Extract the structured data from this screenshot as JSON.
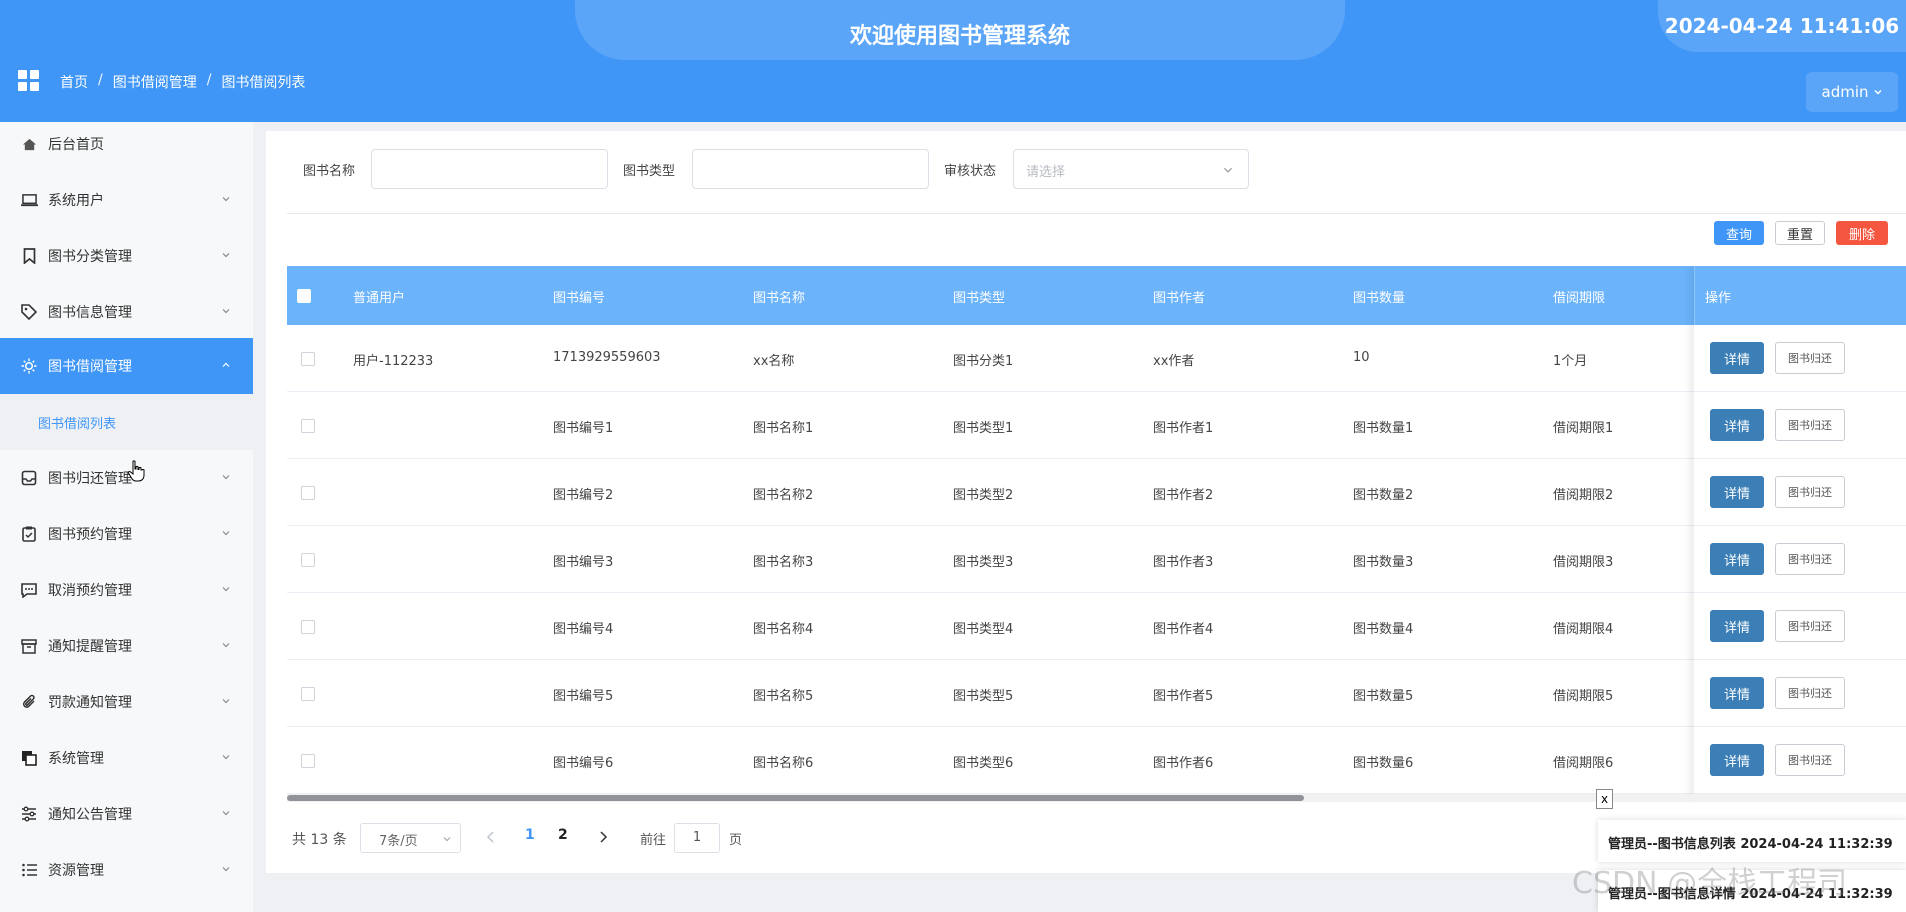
{
  "header": {
    "title": "欢迎使用图书管理系统",
    "clock": "2024-04-24 11:41:06",
    "breadcrumb": [
      "首页",
      "图书借阅管理",
      "图书借阅列表"
    ],
    "user": "admin"
  },
  "sidebar": {
    "items": [
      {
        "label": "后台首页",
        "icon": "home-icon"
      },
      {
        "label": "系统用户",
        "icon": "laptop-icon"
      },
      {
        "label": "图书分类管理",
        "icon": "bookmark-icon"
      },
      {
        "label": "图书信息管理",
        "icon": "tag-icon"
      },
      {
        "label": "图书借阅管理",
        "icon": "sun-icon",
        "active": true
      },
      {
        "label": "图书归还管理",
        "icon": "inbox-icon"
      },
      {
        "label": "图书预约管理",
        "icon": "clipboard-icon"
      },
      {
        "label": "取消预约管理",
        "icon": "chat-icon"
      },
      {
        "label": "通知提醒管理",
        "icon": "archive-icon"
      },
      {
        "label": "罚款通知管理",
        "icon": "paperclip-icon"
      },
      {
        "label": "系统管理",
        "icon": "copy-icon"
      },
      {
        "label": "通知公告管理",
        "icon": "sliders-icon"
      },
      {
        "label": "资源管理",
        "icon": "list-icon"
      }
    ],
    "submenu": {
      "label": "图书借阅列表"
    }
  },
  "search": {
    "book_name_label": "图书名称",
    "book_type_label": "图书类型",
    "audit_label": "审核状态",
    "audit_placeholder": "请选择"
  },
  "actions": {
    "query": "查询",
    "reset": "重置",
    "delete": "删除"
  },
  "table": {
    "headers": [
      "普通用户",
      "图书编号",
      "图书名称",
      "图书类型",
      "图书作者",
      "图书数量",
      "借阅期限"
    ],
    "ops_header": "操作",
    "detail_label": "详情",
    "return_label": "图书归还",
    "rows": [
      [
        "用户-112233",
        "1713929559603",
        "xx名称",
        "图书分类1",
        "xx作者",
        "10",
        "1个月"
      ],
      [
        "",
        "图书编号1",
        "图书名称1",
        "图书类型1",
        "图书作者1",
        "图书数量1",
        "借阅期限1"
      ],
      [
        "",
        "图书编号2",
        "图书名称2",
        "图书类型2",
        "图书作者2",
        "图书数量2",
        "借阅期限2"
      ],
      [
        "",
        "图书编号3",
        "图书名称3",
        "图书类型3",
        "图书作者3",
        "图书数量3",
        "借阅期限3"
      ],
      [
        "",
        "图书编号4",
        "图书名称4",
        "图书类型4",
        "图书作者4",
        "图书数量4",
        "借阅期限4"
      ],
      [
        "",
        "图书编号5",
        "图书名称5",
        "图书类型5",
        "图书作者5",
        "图书数量5",
        "借阅期限5"
      ],
      [
        "",
        "图书编号6",
        "图书名称6",
        "图书类型6",
        "图书作者6",
        "图书数量6",
        "借阅期限6"
      ]
    ]
  },
  "pagination": {
    "total": "共 13 条",
    "page_size": "7条/页",
    "pages": [
      "1",
      "2"
    ],
    "current": "1",
    "goto_label": "前往",
    "goto_value": "1",
    "goto_suffix": "页"
  },
  "notifications": {
    "close": "x",
    "items": [
      "管理员--图书信息列表 2024-04-24 11:32:39",
      "管理员--图书信息详情 2024-04-24 11:32:39"
    ]
  },
  "watermark": "CSDN @全栈工程司",
  "colors": {
    "primary": "#3f96f7",
    "table_header": "#6bb3fb",
    "danger": "#f5563f",
    "detail": "#3b7fb6"
  }
}
